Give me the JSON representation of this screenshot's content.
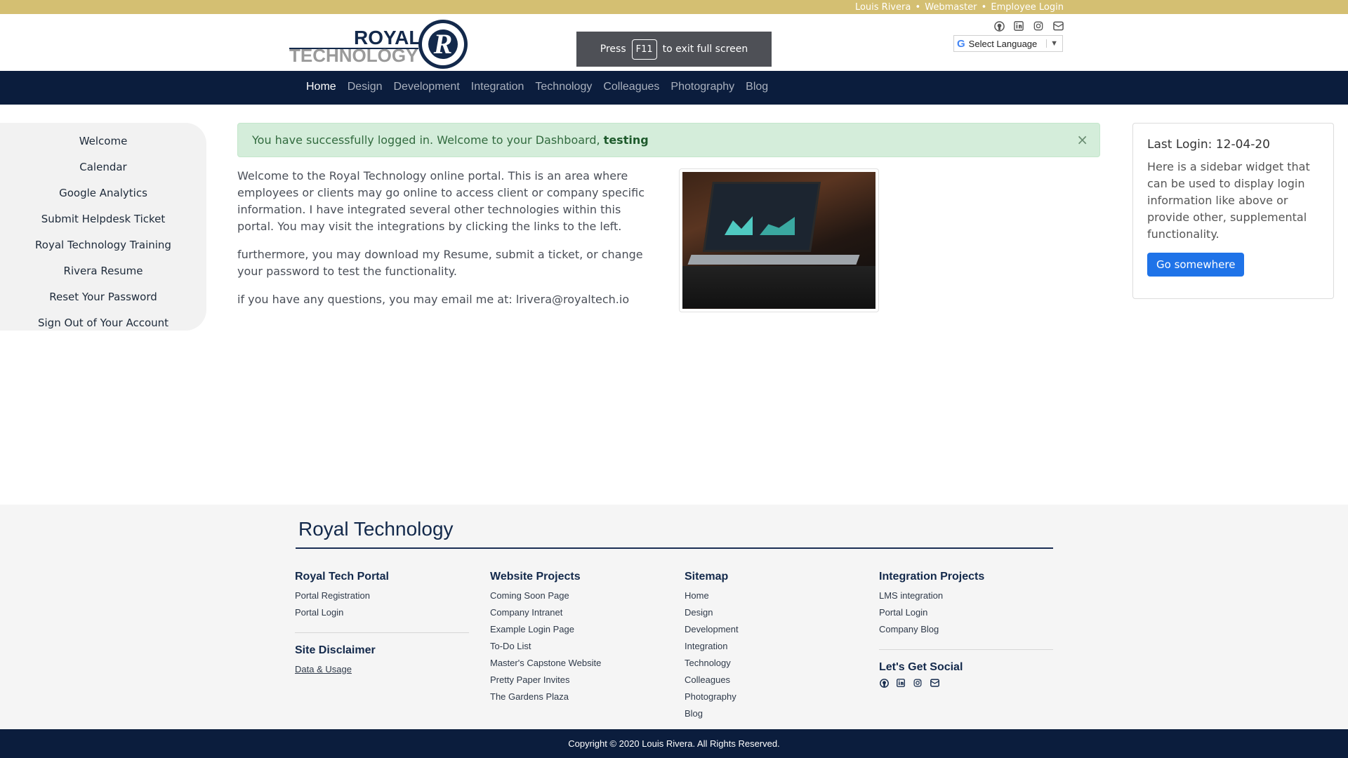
{
  "topbar": {
    "links": [
      "Louis Rivera",
      "Webmaster",
      "Employee Login"
    ],
    "separator": "•"
  },
  "header": {
    "logo": {
      "line1": "ROYAL",
      "line2": "TECHNOLOGY",
      "emblem": "R"
    },
    "fullscreen_notice": {
      "before": "Press",
      "key": "F11",
      "after": "to exit full screen"
    },
    "social_icons": [
      "github-icon",
      "linkedin-icon",
      "instagram-icon",
      "mail-icon"
    ],
    "language": {
      "g": "G",
      "label": "Select Language",
      "arrow": "▼"
    }
  },
  "nav": {
    "items": [
      {
        "label": "Home",
        "active": true
      },
      {
        "label": "Design"
      },
      {
        "label": "Development"
      },
      {
        "label": "Integration"
      },
      {
        "label": "Technology"
      },
      {
        "label": "Colleagues"
      },
      {
        "label": "Photography"
      },
      {
        "label": "Blog"
      }
    ]
  },
  "sidebar": {
    "items": [
      "Welcome",
      "Calendar",
      "Google Analytics",
      "Submit Helpdesk Ticket",
      "Royal Technology Training",
      "Rivera Resume",
      "Reset Your Password",
      "Sign Out of Your Account"
    ]
  },
  "alert": {
    "text": "You have successfully logged in. Welcome to your Dashboard,",
    "user": "testing",
    "close": "×"
  },
  "content": {
    "paragraphs": [
      "Welcome to the Royal Technology online portal. This is an area where employees or clients may go online to access client or company specific information. I have integrated several other technologies within this portal. You may visit the integrations by clicking the links to the left.",
      "furthermore, you may download my Resume, submit a ticket, or change your password to test the functionality.",
      "if you have any questions, you may email me at: lrivera@royaltech.io"
    ]
  },
  "widget": {
    "title": "Last Login: 12-04-20",
    "text": "Here is a sidebar widget that can be used to display login information like above or provide other, supplemental functionality.",
    "button": "Go somewhere"
  },
  "footer": {
    "title": "Royal Technology",
    "columns": [
      {
        "heading": "Royal Tech Portal",
        "links": [
          "Portal Registration",
          "Portal Login"
        ],
        "heading2": "Site Disclaimer",
        "links2": [
          "Data & Usage"
        ]
      },
      {
        "heading": "Website Projects",
        "links": [
          "Coming Soon Page",
          "Company Intranet",
          "Example Login Page",
          "To-Do List",
          "Master's Capstone Website",
          "Pretty Paper Invites",
          "The Gardens Plaza"
        ]
      },
      {
        "heading": "Sitemap",
        "links": [
          "Home",
          "Design",
          "Development",
          "Integration",
          "Technology",
          "Colleagues",
          "Photography",
          "Blog"
        ]
      },
      {
        "heading": "Integration Projects",
        "links": [
          "LMS integration",
          "Portal Login",
          "Company Blog"
        ],
        "heading2": "Let's Get Social",
        "social_icons": [
          "github-icon",
          "linkedin-icon",
          "instagram-icon",
          "mail-icon"
        ]
      }
    ],
    "copyright": "Copyright © 2020 Louis Rivera. All Rights Reserved."
  },
  "colors": {
    "gold": "#d4bf72",
    "navy": "#0b1d3d",
    "alert_bg": "#d4edda",
    "button": "#1f73e8"
  }
}
